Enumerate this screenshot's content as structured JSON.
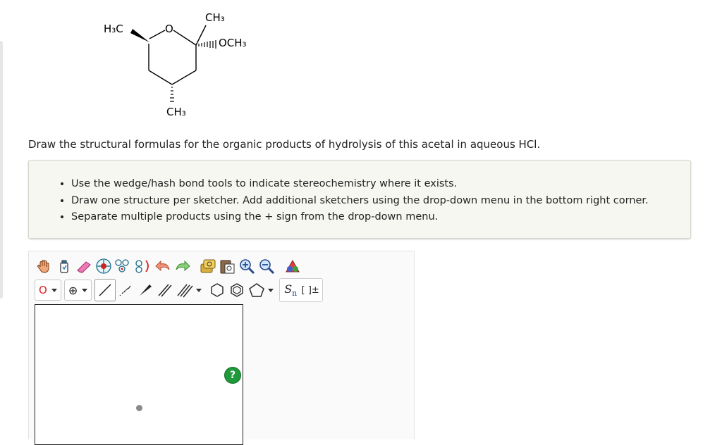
{
  "molecule": {
    "labels": {
      "h3c_left": "H₃C",
      "ring_oxygen": "O",
      "ch3_top": "CH₃",
      "och3": "OCH₃",
      "ch3_bottom": "CH₃"
    }
  },
  "question": "Draw the structural formulas for the organic products of hydrolysis of this acetal in aqueous HCl.",
  "instructions": [
    "Use the wedge/hash bond tools to indicate stereochemistry where it exists.",
    "Draw one structure per sketcher. Add additional sketchers using the drop-down menu in the bottom right corner.",
    "Separate multiple products using the + sign from the drop-down menu."
  ],
  "sketcher": {
    "element_dropdown_value": "O",
    "charge_symbol": "⊕",
    "sn_label": "S",
    "sn_sub": "n",
    "bracket_label": "[ ]±",
    "help_label": "?"
  },
  "colors": {
    "accent_green": "#1e9a3a",
    "element_red": "#e02020",
    "panel_bg": "#f7f7f1"
  }
}
